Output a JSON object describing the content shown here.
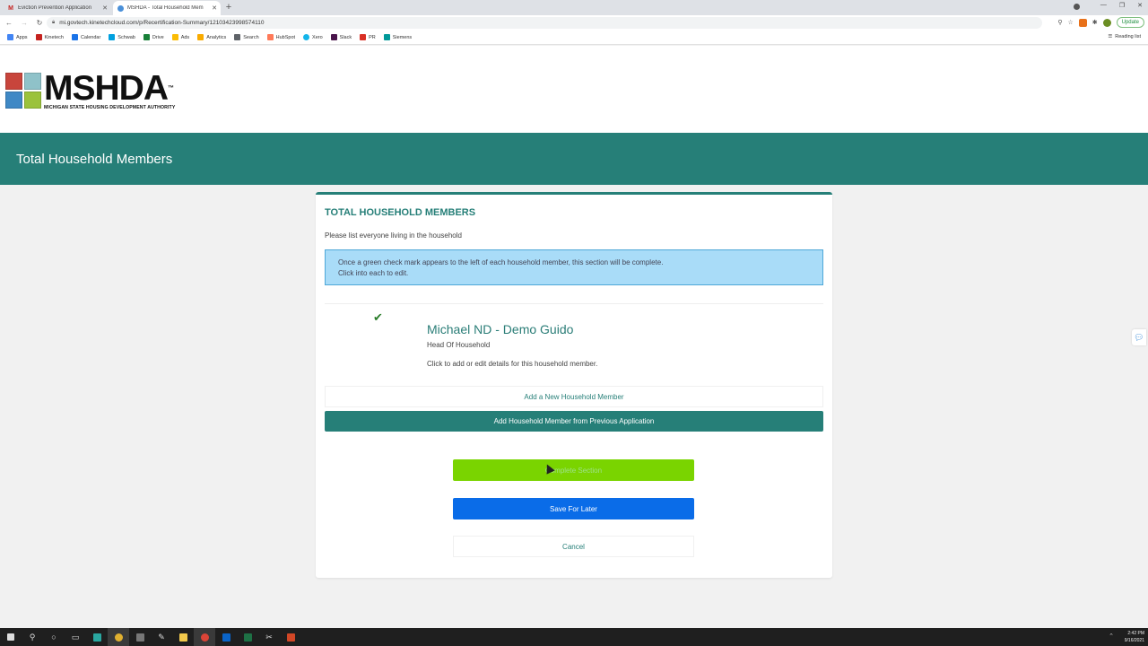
{
  "browser": {
    "tabs": [
      {
        "title": "Eviction Prevention Application",
        "active": false,
        "icon": "gmail-icon",
        "color": "#c5221f"
      },
      {
        "title": "MSHDA - Total Household Mem",
        "active": true,
        "icon": "chrome-page-icon",
        "color": "#4a90d9"
      }
    ],
    "new_tab_label": "+",
    "url": "mi.govtech.kinetechcloud.com/p/Recertification-Summary/12103423998574110",
    "update_label": "Update",
    "bookmarks": [
      {
        "label": "Apps",
        "color": "#4285f4"
      },
      {
        "label": "Kinetech",
        "color": "#c5221f"
      },
      {
        "label": "Calendar",
        "color": "#1a73e8"
      },
      {
        "label": "Schwab",
        "color": "#00a0df"
      },
      {
        "label": "Drive",
        "color": "#188038"
      },
      {
        "label": "Ads",
        "color": "#fbbc04"
      },
      {
        "label": "Analytics",
        "color": "#f9ab00"
      },
      {
        "label": "Search",
        "color": "#5f6368"
      },
      {
        "label": "HubSpot",
        "color": "#ff7a59"
      },
      {
        "label": "Xero",
        "color": "#13b5ea"
      },
      {
        "label": "Slack",
        "color": "#4a154b"
      },
      {
        "label": "PR",
        "color": "#d93025"
      },
      {
        "label": "Siemens",
        "color": "#009999"
      }
    ],
    "reading_list_label": "Reading list"
  },
  "logo": {
    "word": "MSHDA",
    "tm": "™",
    "subtitle": "MICHIGAN STATE HOUSING DEVELOPMENT AUTHORITY",
    "tile_colors": [
      "#c8453c",
      "#8fc2c9",
      "#3f88c5",
      "#9bc23c"
    ]
  },
  "banner": {
    "title": "Total Household Members"
  },
  "card": {
    "heading": "TOTAL HOUSEHOLD MEMBERS",
    "subheading": "Please list everyone living in the household",
    "info_line1": "Once a green check mark appears to the left of each household member, this section will be complete.",
    "info_line2": "Click into each to edit."
  },
  "member": {
    "name": "Michael ND - Demo Guido",
    "role": "Head Of Household",
    "hint": "Click to add or edit details for this household member.",
    "complete": true
  },
  "actions": {
    "add_new": "Add a New Household Member",
    "add_previous": "Add Household Member from Previous Application",
    "complete": "Complete Section",
    "save": "Save For Later",
    "cancel": "Cancel"
  },
  "taskbar": {
    "time": "2:42 PM",
    "date": "9/16/2021"
  },
  "colors": {
    "brand_teal": "#267f78",
    "complete_green": "#7ad400",
    "save_blue": "#0a6ce8",
    "info_bg": "#a9dcf8"
  }
}
